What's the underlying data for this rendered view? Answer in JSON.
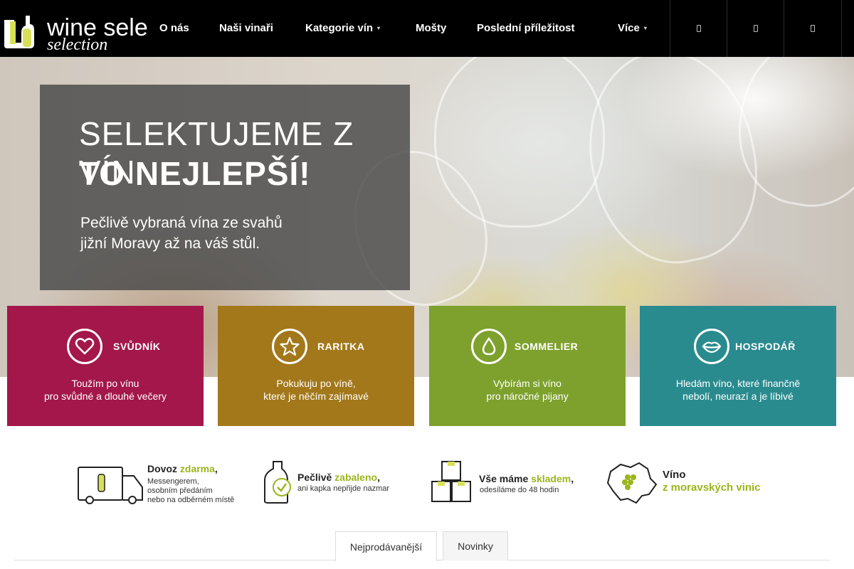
{
  "header": {
    "logo_text": "wine selection",
    "nav": [
      {
        "label": "O nás"
      },
      {
        "label": "Naši vinaři"
      },
      {
        "label": "Kategorie vín",
        "has_submenu": true
      },
      {
        "label": "Mošty"
      },
      {
        "label": "Poslední příležitost"
      },
      {
        "label": "Více",
        "has_submenu": true
      }
    ],
    "icons": [
      "search-icon",
      "account-icon",
      "cart-icon"
    ]
  },
  "hero": {
    "line1": "SELEKTUJEME Z VÍN",
    "line2": "TO NEJLEPŠÍ!",
    "sub_line1": "Pečlivě vybraná vína ze svahů",
    "sub_line2": "jižní Moravy až na váš stůl."
  },
  "categories": [
    {
      "title": "SVŮDNÍK",
      "desc1": "Toužím po vínu",
      "desc2": "pro svůdné a dlouhé večery",
      "color": "#a3174a",
      "icon": "heart-icon"
    },
    {
      "title": "RARITKA",
      "desc1": "Pokukuju po víně,",
      "desc2": "které je něčím zajímavé",
      "color": "#a2781b",
      "icon": "star-icon"
    },
    {
      "title": "SOMMELIER",
      "desc1": "Vybírám si víno",
      "desc2": "pro náročné pijany",
      "color": "#7da12c",
      "icon": "drop-icon"
    },
    {
      "title": "HOSPODÁŘ",
      "desc1": "Hledám víno, které finančně",
      "desc2": "nebolí, neurazí a je líbivé",
      "color": "#2a8b8f",
      "icon": "lips-icon"
    }
  ],
  "benefits": [
    {
      "icon": "truck-icon",
      "title_a": "Dovoz ",
      "title_hl": "zdarma",
      "title_b": ",",
      "sub": [
        "Messengerem,",
        "osobním předáním",
        "nebo na odběrném místě"
      ]
    },
    {
      "icon": "bottle-check-icon",
      "title_a": "Pečlivě ",
      "title_hl": "zabaleno",
      "title_b": ",",
      "sub": [
        "ani kapka nepřijde nazmar"
      ]
    },
    {
      "icon": "boxes-icon",
      "title_a": "Vše máme ",
      "title_hl": "skladem",
      "title_b": ",",
      "sub": [
        "odesíláme do 48 hodin"
      ]
    },
    {
      "icon": "moravia-map-icon",
      "title_a": "Víno",
      "title_hl": "",
      "title_b": "",
      "title2": "z moravských vinic",
      "sub": []
    }
  ],
  "tabs": [
    {
      "label": "Nejprodávanější",
      "active": true
    },
    {
      "label": "Novinky",
      "active": false
    }
  ],
  "colors": {
    "accent_green": "#9bb51d",
    "header_bg": "#000000"
  }
}
